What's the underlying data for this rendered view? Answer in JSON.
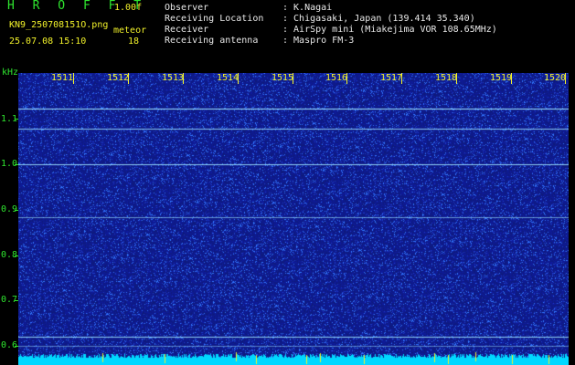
{
  "header": {
    "app_name": "H R O F F T",
    "version": "1.00f",
    "filename": "KN9_250708151O.png",
    "datetime": "25.07.08 15:10",
    "meteor_label": "meteor",
    "meteor_count": "18",
    "meta": [
      {
        "key": "Observer",
        "value": ": K.Nagai"
      },
      {
        "key": "Receiving Location",
        "value": ": Chigasaki, Japan (139.414 35.340)"
      },
      {
        "key": "Receiver",
        "value": ": AirSpy mini (Miakejima VOR 108.65MHz)"
      },
      {
        "key": "Receiving antenna",
        "value": ": Maspro FM-3"
      }
    ]
  },
  "axes": {
    "y_unit": "kHz",
    "y_ticks": [
      "1.1",
      "1.0",
      "0.9",
      "0.8",
      "0.7",
      "0.6"
    ],
    "x_ticks": [
      "1511",
      "1512",
      "1513",
      "1514",
      "1515",
      "1516",
      "1517",
      "1518",
      "1519",
      "1520"
    ]
  },
  "colors": {
    "background": "#000000",
    "waterfall_base": "#10208a",
    "noise_bright": "#4a9cff",
    "signal_line": "#9fe6ff",
    "floor_trace": "#00d8ff",
    "labels_green": "#2fe52f",
    "labels_yellow": "#f2f22a"
  }
}
